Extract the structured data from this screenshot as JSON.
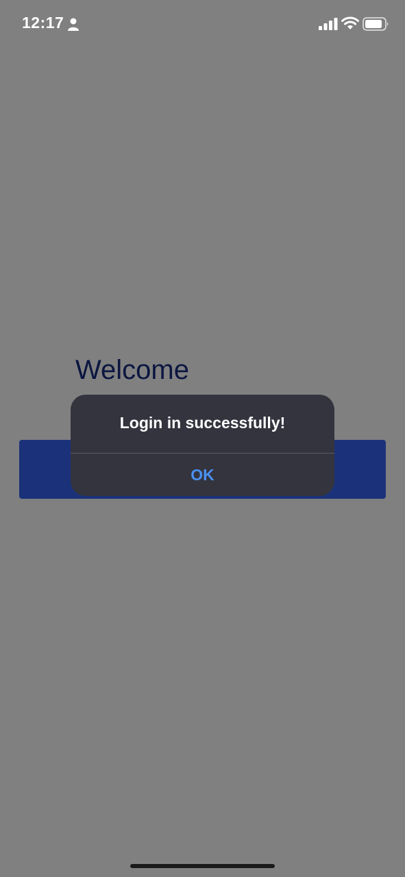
{
  "status_bar": {
    "time": "12:17",
    "icons": [
      "person-icon",
      "signal-icon",
      "wifi-icon",
      "battery-icon"
    ]
  },
  "screen": {
    "welcome_title": "Welcome"
  },
  "alert": {
    "title": "Login in successfully!",
    "ok_label": "OK"
  },
  "colors": {
    "overlay": "#808080",
    "alert_bg": "#33343e",
    "ok_text": "#4a90f0",
    "button_bg": "#1b327a",
    "welcome_text": "#0b1640"
  }
}
